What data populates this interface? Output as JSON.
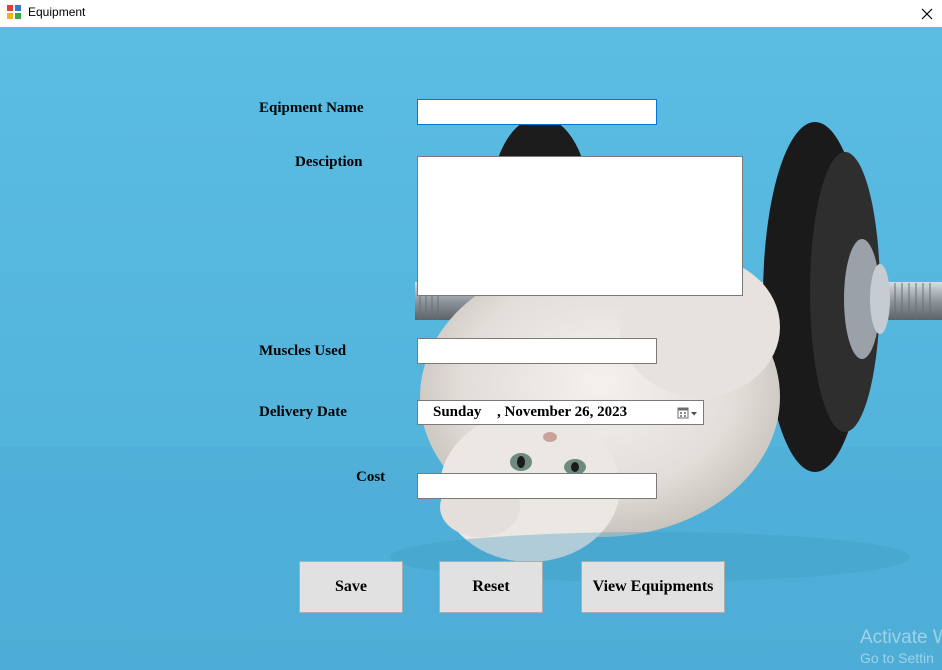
{
  "window": {
    "title": "Equipment",
    "close_glyph": "✕",
    "icon": "winforms-app-icon"
  },
  "form": {
    "equipment_name_label": "Eqipment Name",
    "description_label": "Desciption",
    "muscles_label": "Muscles Used",
    "delivery_label": "Delivery Date",
    "cost_label": "Cost",
    "equipment_name_value": "",
    "description_value": "",
    "muscles_value": "",
    "cost_value": "",
    "delivery_day": "Sunday",
    "delivery_date": ", November 26, 2023",
    "calendar_icon": "calendar-dropdown-icon"
  },
  "buttons": {
    "save": "Save",
    "reset": "Reset",
    "view": "View Equipments"
  },
  "watermark": {
    "line1": "Activate W",
    "line2": "Go to Settin"
  },
  "background": {
    "image": "kitten-with-dumbbell",
    "color": "#55b6de"
  }
}
